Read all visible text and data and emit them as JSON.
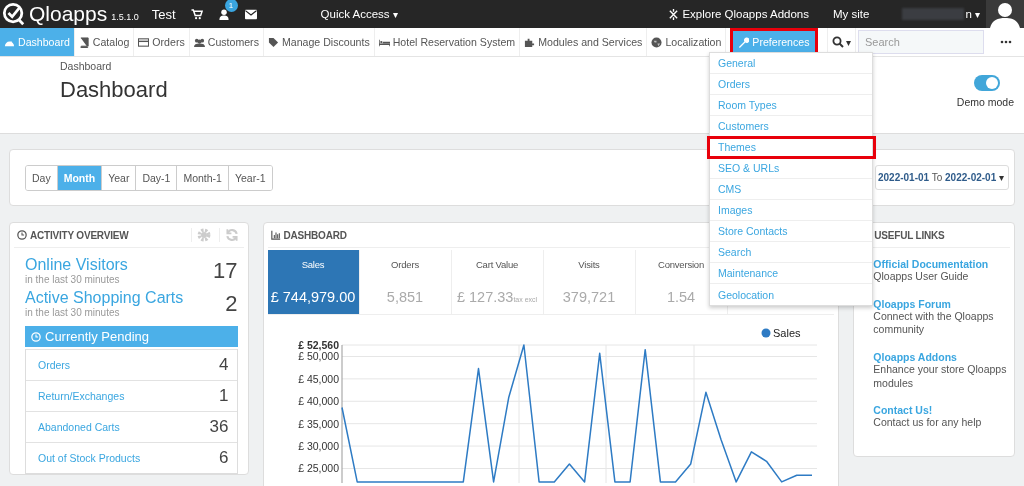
{
  "top_bar": {
    "brand": "Qloapps",
    "version": "1.5.1.0",
    "shop": "Test",
    "notification_count": "1",
    "quick_access": "Quick Access",
    "quick_access_caret": "▾",
    "user_caret": "▾",
    "search_caret": "▾",
    "explore": "Explore Qloapps Addons",
    "my_site": "My site",
    "user": "n"
  },
  "nav": [
    {
      "label": "Dashboard",
      "selected": true,
      "expanded": false,
      "highlighted": false
    },
    {
      "label": "Catalog",
      "selected": false,
      "expanded": false,
      "highlighted": false
    },
    {
      "label": "Orders",
      "selected": false,
      "expanded": false,
      "highlighted": false
    },
    {
      "label": "Customers",
      "selected": false,
      "expanded": false,
      "highlighted": false
    },
    {
      "label": "Manage Discounts",
      "selected": false,
      "expanded": false,
      "highlighted": false
    },
    {
      "label": "Hotel Reservation System",
      "selected": false,
      "expanded": false,
      "highlighted": false
    },
    {
      "label": "Modules and Services",
      "selected": false,
      "expanded": false,
      "highlighted": false
    },
    {
      "label": "Localization",
      "selected": false,
      "expanded": false,
      "highlighted": false
    },
    {
      "label": "Preferences",
      "selected": false,
      "expanded": true,
      "highlighted": true
    }
  ],
  "search": {
    "placeholder": "Search"
  },
  "preferences_menu": [
    {
      "label": "General",
      "highlighted": false
    },
    {
      "label": "Orders",
      "highlighted": false
    },
    {
      "label": "Room Types",
      "highlighted": false
    },
    {
      "label": "Customers",
      "highlighted": false
    },
    {
      "label": "Themes",
      "highlighted": true
    },
    {
      "label": "SEO & URLs",
      "highlighted": false
    },
    {
      "label": "CMS",
      "highlighted": false
    },
    {
      "label": "Images",
      "highlighted": false
    },
    {
      "label": "Store Contacts",
      "highlighted": false
    },
    {
      "label": "Search",
      "highlighted": false
    },
    {
      "label": "Maintenance",
      "highlighted": false
    },
    {
      "label": "Geolocation",
      "highlighted": false
    }
  ],
  "header": {
    "breadcrumb": "Dashboard",
    "title": "Dashboard",
    "demo_mode": {
      "label": "Demo mode",
      "on": true
    }
  },
  "periods": [
    {
      "label": "Day",
      "selected": false
    },
    {
      "label": "Month",
      "selected": true
    },
    {
      "label": "Year",
      "selected": false
    },
    {
      "label": "Day-1",
      "selected": false
    },
    {
      "label": "Month-1",
      "selected": false
    },
    {
      "label": "Year-1",
      "selected": false
    }
  ],
  "date_range": {
    "from": "2022-01-01",
    "to_label": "To",
    "to": "2022-02-01",
    "caret": "▾"
  },
  "activity": {
    "title": "ACTIVITY OVERVIEW",
    "stats": [
      {
        "label": "Online Visitors",
        "sub": "in the last 30 minutes",
        "value": "17"
      },
      {
        "label": "Active Shopping Carts",
        "sub": "in the last 30 minutes",
        "value": "2"
      }
    ],
    "pending_title": "Currently Pending",
    "pending": [
      {
        "label": "Orders",
        "value": "4"
      },
      {
        "label": "Return/Exchanges",
        "value": "1"
      },
      {
        "label": "Abandoned Carts",
        "value": "36"
      },
      {
        "label": "Out of Stock Products",
        "value": "6"
      }
    ]
  },
  "dashboard": {
    "title": "DASHBOARD",
    "kpis": [
      {
        "label": "Sales",
        "value": "£ 744,979.00",
        "selected": true
      },
      {
        "label": "Orders",
        "value": "5,851",
        "selected": false
      },
      {
        "label": "Cart Value",
        "value": "£ 127.33",
        "note": "tax excl",
        "selected": false
      },
      {
        "label": "Visits",
        "value": "379,721",
        "selected": false
      },
      {
        "label": "Conversion",
        "value": "1.54",
        "selected": false
      }
    ],
    "chart_data": {
      "type": "line",
      "grid": true,
      "ylim": [
        21700,
        52560
      ],
      "yticks": [
        {
          "value": 25000,
          "label": "£ 25,000"
        },
        {
          "value": 30000,
          "label": "£ 30,000"
        },
        {
          "value": 35000,
          "label": "£ 35,000"
        },
        {
          "value": 40000,
          "label": "£ 40,000"
        },
        {
          "value": 45000,
          "label": "£ 45,000"
        },
        {
          "value": 50000,
          "label": "£ 50,000"
        },
        {
          "value": 52560,
          "label": "£ 52,560"
        }
      ],
      "series": [
        {
          "name": "Sales",
          "color": "#2e7bc4",
          "values": [
            38600,
            22000,
            22000,
            22000,
            22000,
            22000,
            22000,
            22000,
            22000,
            47300,
            22000,
            40900,
            52560,
            22000,
            22000,
            26000,
            22000,
            50700,
            22000,
            22000,
            51500,
            22000,
            22000,
            26000,
            42000,
            31500,
            22000,
            28700,
            26600,
            22000,
            23500,
            23500
          ]
        }
      ]
    }
  },
  "useful_links": {
    "title": "USEFUL LINKS",
    "links": [
      {
        "title": "Official Documentation",
        "text": "Qloapps User Guide"
      },
      {
        "title": "Qloapps Forum",
        "text": "Connect with the Qloapps community"
      },
      {
        "title": "Qloapps Addons",
        "text": "Enhance your store Qloapps modules"
      },
      {
        "title": "Contact Us!",
        "text": "Contact us for any help"
      }
    ]
  }
}
